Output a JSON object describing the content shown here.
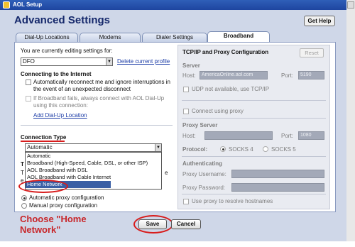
{
  "window": {
    "title": "AOL Setup"
  },
  "header": {
    "title": "Advanced Settings",
    "help_label": "Get Help"
  },
  "tabs": [
    {
      "label": "Dial-Up Locations"
    },
    {
      "label": "Modems"
    },
    {
      "label": "Dialer Settings"
    },
    {
      "label": "Broadband"
    }
  ],
  "left": {
    "editing_label": "You are currently editing settings for:",
    "location_value": "DFO",
    "delete_link": "Delete current profile",
    "connecting_heading": "Connecting to the Internet",
    "auto_reconnect_text_1": "Automatically reconnect me and ignore interruptions in",
    "auto_reconnect_text_2": "the event of an unexpected disconnect",
    "fallback_text_1": "If Broadband fails, always connect with AOL Dial-Up",
    "fallback_text_2": "using this connection:",
    "add_dialup_link": "Add Dial-Up Location",
    "connection_type_heading": "Connection Type",
    "connection_type_value": "Automatic",
    "connection_options": [
      "Automatic",
      "Broadband (High-Speed, Cable, DSL, or other ISP)",
      "AOL Broadband with DSL",
      "AOL Broadband with Cable Internet",
      "Home Network"
    ],
    "selected_option_index": 4,
    "hidden_partial_1": "T",
    "hidden_partial_2": "T",
    "hidden_partial_3": "e",
    "hidden_partial_4": "e",
    "auto_proxy_label": "Automatic proxy configuration",
    "manual_proxy_label": "Manual proxy configuration"
  },
  "right": {
    "heading": "TCP/IP and Proxy Configuration",
    "reset_label": "Reset",
    "server_heading": "Server",
    "host_label": "Host:",
    "host_value": "AmericaOnline.aol.com",
    "port_label": "Port:",
    "port_value": "5190",
    "udp_label": "UDP not available, use TCP/IP",
    "connect_proxy_label": "Connect using proxy",
    "proxy_server_heading": "Proxy Server",
    "proxy_host_label": "Host:",
    "proxy_port_label": "Port:",
    "proxy_port_value": "1080",
    "protocol_label": "Protocol:",
    "socks4_label": "SOCKS 4",
    "socks5_label": "SOCKS 5",
    "auth_heading": "Authenticating",
    "username_label": "Proxy Username:",
    "password_label": "Proxy Password:",
    "resolve_label": "Use proxy to resolve hostnames"
  },
  "annotation": {
    "line1": "Choose \"Home",
    "line2": "Network\""
  },
  "footer": {
    "save_label": "Save",
    "cancel_label": "Cancel"
  },
  "colors": {
    "title_bar": "#1e45a0",
    "heading": "#15286b",
    "annotation": "#d81c1c",
    "selected_option": "#3a5fa5"
  }
}
